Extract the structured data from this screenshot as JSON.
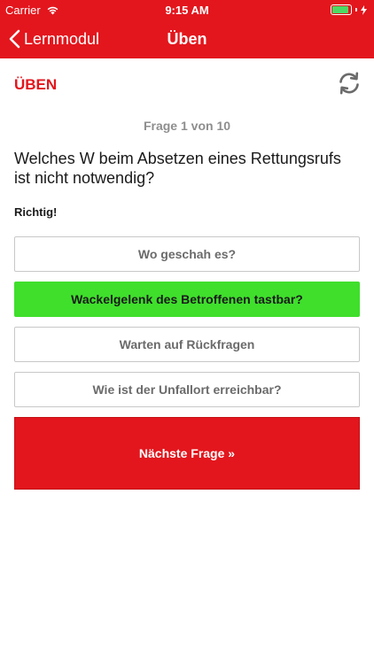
{
  "status": {
    "carrier": "Carrier",
    "time": "9:15 AM"
  },
  "nav": {
    "back_label": "Lernmodul",
    "title": "Üben"
  },
  "section": {
    "title": "ÜBEN"
  },
  "quiz": {
    "counter": "Frage 1 von 10",
    "question": "Welches W beim Absetzen eines Rettungsrufs ist nicht notwendig?",
    "feedback": "Richtig!",
    "answers": [
      {
        "label": "Wo geschah es?",
        "state": "default"
      },
      {
        "label": "Wackelgelenk des Betroffenen tastbar?",
        "state": "correct"
      },
      {
        "label": "Warten auf Rückfragen",
        "state": "default"
      },
      {
        "label": "Wie ist der Unfallort erreichbar?",
        "state": "default"
      }
    ],
    "next_label": "Nächste Frage »"
  },
  "colors": {
    "brand": "#e3161d",
    "correct": "#3fdf2c"
  },
  "icons": {
    "back": "chevron-left-icon",
    "refresh": "refresh-icon",
    "wifi": "wifi-icon",
    "battery": "battery-icon"
  }
}
